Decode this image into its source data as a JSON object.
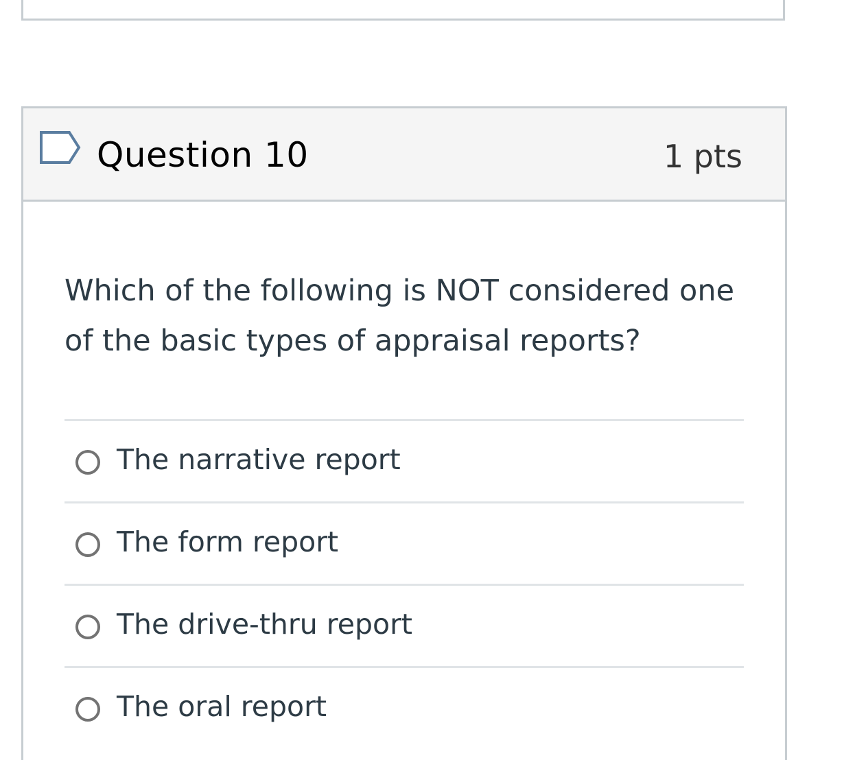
{
  "question": {
    "title": "Question 10",
    "points": "1 pts",
    "text": "Which of the following is NOT considered one of the basic types of appraisal reports?",
    "flag_icon": "bookmark-flag-outline-icon",
    "answers": [
      {
        "label": "The narrative report",
        "selected": false
      },
      {
        "label": "The form report",
        "selected": false
      },
      {
        "label": "The drive-thru report",
        "selected": false
      },
      {
        "label": "The oral report",
        "selected": false
      }
    ]
  },
  "colors": {
    "header_bg": "#f5f5f5",
    "border": "#c7cdd1",
    "flag_stroke": "#5a7da0",
    "text": "#2d3b45"
  }
}
